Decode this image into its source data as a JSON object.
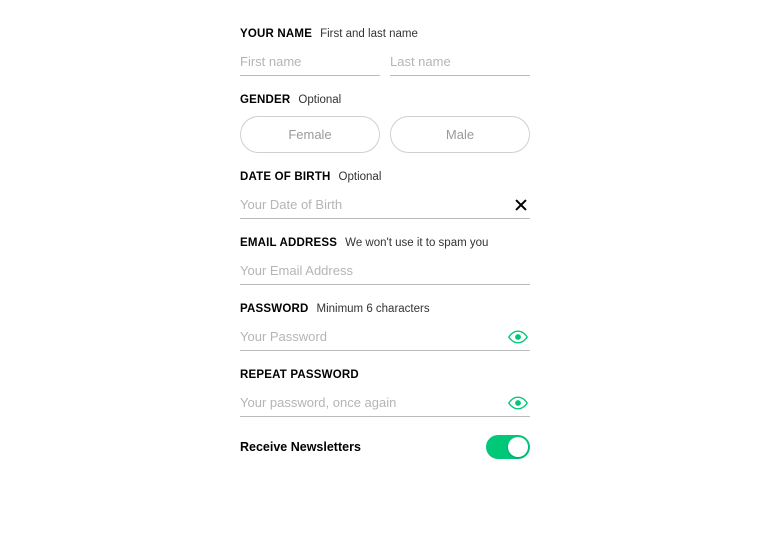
{
  "name": {
    "label": "YOUR NAME",
    "hint": "First and last name",
    "first_placeholder": "First name",
    "last_placeholder": "Last name"
  },
  "gender": {
    "label": "GENDER",
    "hint": "Optional",
    "options": {
      "female": "Female",
      "male": "Male"
    }
  },
  "dob": {
    "label": "DATE OF BIRTH",
    "hint": "Optional",
    "placeholder": "Your Date of Birth"
  },
  "email": {
    "label": "EMAIL ADDRESS",
    "hint": "We won't use it to spam you",
    "placeholder": "Your Email Address"
  },
  "password": {
    "label": "PASSWORD",
    "hint": "Minimum 6 characters",
    "placeholder": "Your Password"
  },
  "repeat_password": {
    "label": "REPEAT PASSWORD",
    "placeholder": "Your password, once again"
  },
  "newsletter": {
    "label": "Receive Newsletters",
    "value": true
  },
  "colors": {
    "accent": "#00c878"
  }
}
